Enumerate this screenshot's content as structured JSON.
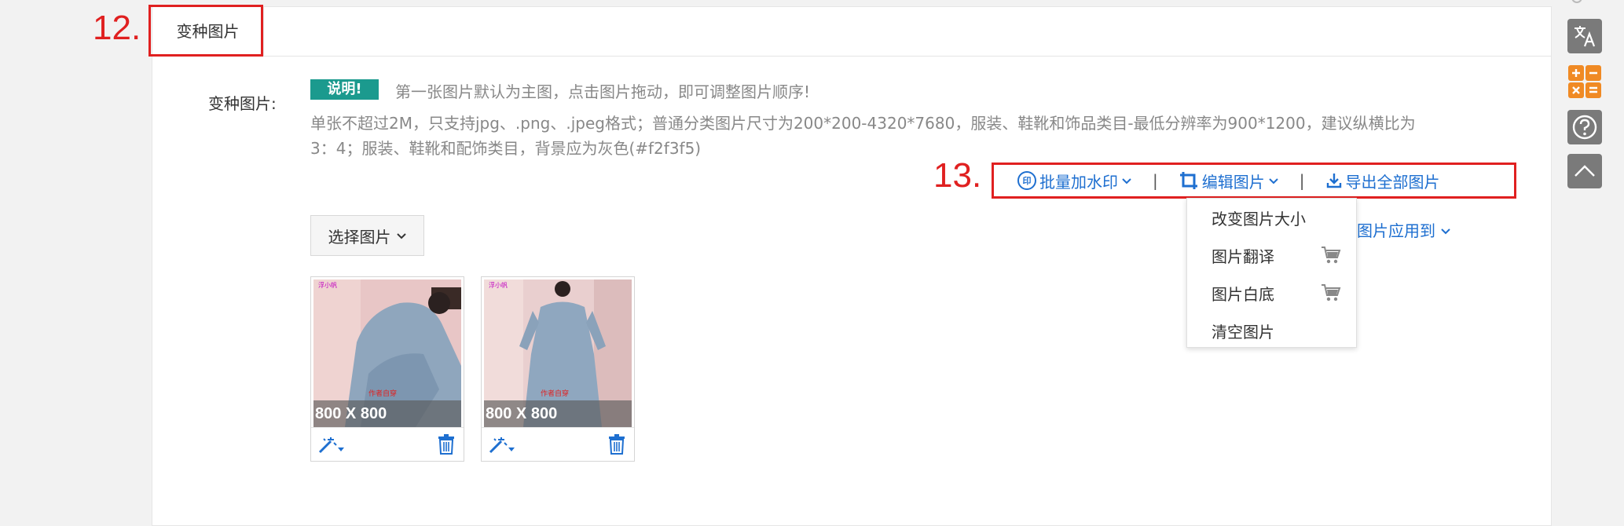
{
  "section": {
    "tab_label": "变种图片",
    "annotation_12": "12.",
    "annotation_13": "13."
  },
  "variant_images": {
    "field_label": "变种图片:",
    "badge": "说明!",
    "note_main": "第一张图片默认为主图，点击图片拖动，即可调整图片顺序!",
    "note_line1": "单张不超过2M，只支持jpg、.png、.jpeg格式；普通分类图片尺寸为200*200-4320*7680，服装、鞋靴和饰品类目-最低分辨率为900*1200，建议纵横比为",
    "note_line2": "3：4；服装、鞋靴和配饰类目，背景应为灰色(#f2f3f5)"
  },
  "toolbar": {
    "watermark_icon_text": "印",
    "watermark_label": "批量加水印",
    "separator": "|",
    "edit_label": "编辑图片",
    "export_label": "导出全部图片",
    "apply_label": "图片应用到"
  },
  "select_button": {
    "label": "选择图片"
  },
  "thumbnails": [
    {
      "size": "800 X 800",
      "image": "denim-shirt-dress-seated"
    },
    {
      "size": "800 X 800",
      "image": "denim-shirt-dress-standing"
    }
  ],
  "dropdown": {
    "items": [
      "改变图片大小",
      "图片翻译",
      "图片白底",
      "清空图片"
    ]
  },
  "colors": {
    "accent_blue": "#1e6fd0",
    "badge_teal": "#1b9a8e",
    "annotation_red": "#e02020",
    "sidebar_gray": "#7a7a7a"
  },
  "icons": {
    "watermark": "watermark-icon",
    "crop": "crop-icon",
    "download": "download-icon",
    "cart": "cart-icon",
    "magic_wand": "magic-wand-icon",
    "trash": "trash-icon",
    "translate": "translate-icon",
    "calculator": "calculator-icon",
    "help": "help-icon",
    "scroll_top": "chevron-up-icon"
  }
}
